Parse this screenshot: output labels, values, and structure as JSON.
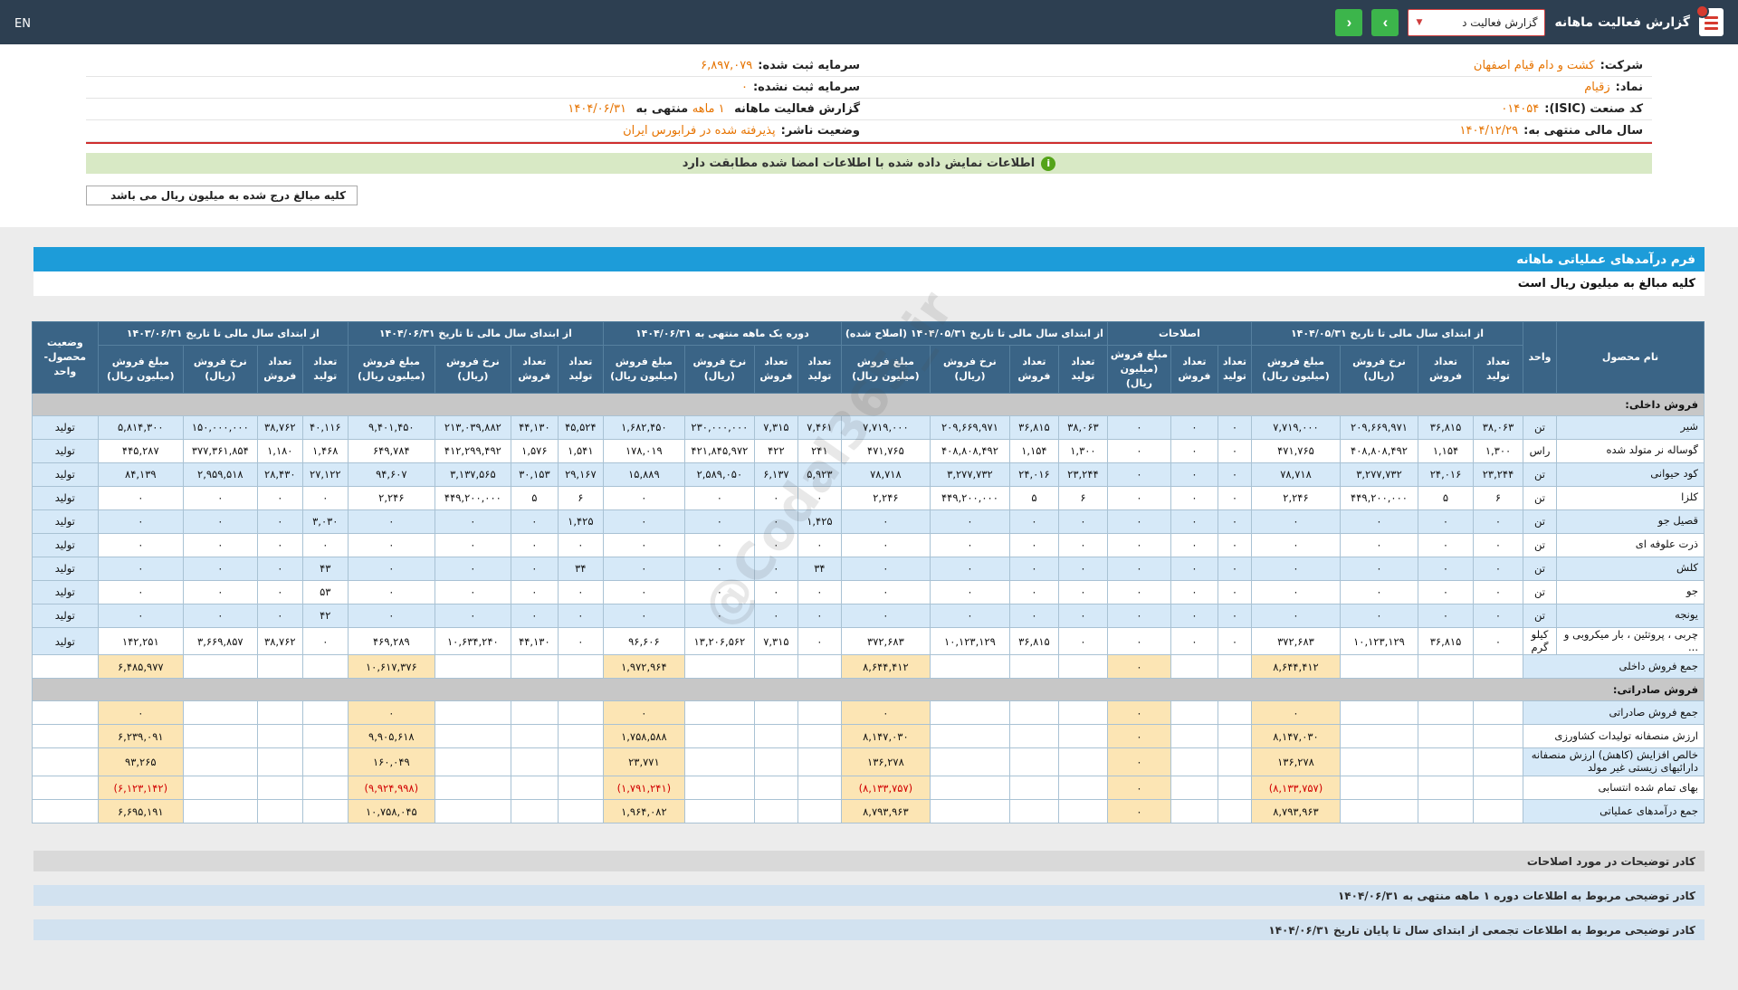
{
  "navbar": {
    "title": "گزارش فعالیت ماهانه",
    "dropdown_value": "گزارش فعالیت د",
    "arrow_next": "›",
    "arrow_prev": "‹",
    "lang": "EN",
    "accent_color": "#cf3d3d",
    "button_color": "#3cb54b"
  },
  "company_info": {
    "right": [
      {
        "label": "شرکت:",
        "value": "کشت و دام قیام اصفهان"
      },
      {
        "label": "نماد:",
        "value": "زقیام"
      },
      {
        "label": "کد صنعت (ISIC):",
        "value": "۰۱۴۰۵۴"
      },
      {
        "label": "سال مالی منتهی به:",
        "value": "۱۴۰۴/۱۲/۲۹"
      }
    ],
    "left": [
      {
        "label": "سرمایه ثبت شده:",
        "value": "۶,۸۹۷,۰۷۹"
      },
      {
        "label": "سرمایه ثبت نشده:",
        "value": "۰"
      },
      {
        "parts": [
          {
            "t": "گزارش فعالیت ماهانه ",
            "accent": false
          },
          {
            "t": "۱ ماهه",
            "accent": true
          },
          {
            "t": " منتهی به ",
            "accent": false
          },
          {
            "t": "۱۴۰۴/۰۶/۳۱",
            "accent": true
          }
        ]
      },
      {
        "label": "وضعیت ناشر:",
        "value": "پذیرفته شده در فرابورس ایران"
      }
    ]
  },
  "notice": "اطلاعات نمایش داده شده با اطلاعات امضا شده مطابقت دارد",
  "amounts_note_box": "کلیه مبالغ درج شده به میلیون ریال می باشد",
  "form": {
    "title": "فرم درآمدهای عملیاتی ماهانه",
    "subtitle": "کلیه مبالغ به میلیون ریال است"
  },
  "watermark": "@Codal365_ir",
  "table": {
    "col_product": "نام محصول",
    "col_unit": "واحد",
    "col_status": "وضعیت محصول-واحد",
    "sub": {
      "prod": "تعداد تولید",
      "sale": "تعداد فروش",
      "rate": "نرخ فروش (ریال)",
      "amt": "مبلغ فروش (میلیون ریال)"
    },
    "groups": [
      {
        "label": "از ابتدای سال مالی تا تاریخ ۱۴۰۴/۰۵/۳۱",
        "cols": [
          "prod",
          "sale",
          "rate",
          "amt"
        ]
      },
      {
        "label": "اصلاحات",
        "cols": [
          "prod",
          "sale",
          "amt"
        ]
      },
      {
        "label": "از ابتدای سال مالی تا تاریخ ۱۴۰۴/۰۵/۳۱ (اصلاح شده)",
        "cols": [
          "prod",
          "sale",
          "rate",
          "amt"
        ]
      },
      {
        "label": "دوره یک ماهه منتهی به ۱۴۰۴/۰۶/۳۱",
        "cols": [
          "prod",
          "sale",
          "rate",
          "amt"
        ]
      },
      {
        "label": "از ابتدای سال مالی تا تاریخ ۱۴۰۴/۰۶/۳۱",
        "cols": [
          "prod",
          "sale",
          "rate",
          "amt"
        ]
      },
      {
        "label": "از ابتدای سال مالی تا تاریخ ۱۴۰۳/۰۶/۳۱",
        "cols": [
          "prod",
          "sale",
          "rate",
          "amt"
        ]
      }
    ],
    "rows": [
      {
        "type": "section",
        "name": "فروش داخلی:"
      },
      {
        "type": "product",
        "name": "شیر",
        "unit": "تن",
        "status": "تولید",
        "cells": [
          "۳۸,۰۶۳",
          "۳۶,۸۱۵",
          "۲۰۹,۶۶۹,۹۷۱",
          "۷,۷۱۹,۰۰۰",
          "۰",
          "۰",
          "۰",
          "۳۸,۰۶۳",
          "۳۶,۸۱۵",
          "۲۰۹,۶۶۹,۹۷۱",
          "۷,۷۱۹,۰۰۰",
          "۷,۴۶۱",
          "۷,۳۱۵",
          "۲۳۰,۰۰۰,۰۰۰",
          "۱,۶۸۲,۴۵۰",
          "۴۵,۵۲۴",
          "۴۴,۱۳۰",
          "۲۱۳,۰۳۹,۸۸۲",
          "۹,۴۰۱,۴۵۰",
          "۴۰,۱۱۶",
          "۳۸,۷۶۲",
          "۱۵۰,۰۰۰,۰۰۰",
          "۵,۸۱۴,۳۰۰"
        ]
      },
      {
        "type": "product",
        "name": "گوساله نر متولد شده",
        "unit": "راس",
        "status": "تولید",
        "cells": [
          "۱,۳۰۰",
          "۱,۱۵۴",
          "۴۰۸,۸۰۸,۴۹۲",
          "۴۷۱,۷۶۵",
          "۰",
          "۰",
          "۰",
          "۱,۳۰۰",
          "۱,۱۵۴",
          "۴۰۸,۸۰۸,۴۹۲",
          "۴۷۱,۷۶۵",
          "۲۴۱",
          "۴۲۲",
          "۴۲۱,۸۴۵,۹۷۲",
          "۱۷۸,۰۱۹",
          "۱,۵۴۱",
          "۱,۵۷۶",
          "۴۱۲,۲۹۹,۴۹۲",
          "۶۴۹,۷۸۴",
          "۱,۴۶۸",
          "۱,۱۸۰",
          "۳۷۷,۳۶۱,۸۵۴",
          "۴۴۵,۲۸۷"
        ]
      },
      {
        "type": "product",
        "name": "کود حیوانی",
        "unit": "تن",
        "status": "تولید",
        "cells": [
          "۲۳,۲۴۴",
          "۲۴,۰۱۶",
          "۳,۲۷۷,۷۳۲",
          "۷۸,۷۱۸",
          "۰",
          "۰",
          "۰",
          "۲۳,۲۴۴",
          "۲۴,۰۱۶",
          "۳,۲۷۷,۷۳۲",
          "۷۸,۷۱۸",
          "۵,۹۲۳",
          "۶,۱۳۷",
          "۲,۵۸۹,۰۵۰",
          "۱۵,۸۸۹",
          "۲۹,۱۶۷",
          "۳۰,۱۵۳",
          "۳,۱۳۷,۵۶۵",
          "۹۴,۶۰۷",
          "۲۷,۱۲۲",
          "۲۸,۴۳۰",
          "۲,۹۵۹,۵۱۸",
          "۸۴,۱۳۹"
        ]
      },
      {
        "type": "product",
        "name": "کلزا",
        "unit": "تن",
        "status": "تولید",
        "cells": [
          "۶",
          "۵",
          "۴۴۹,۲۰۰,۰۰۰",
          "۲,۲۴۶",
          "۰",
          "۰",
          "۰",
          "۶",
          "۵",
          "۴۴۹,۲۰۰,۰۰۰",
          "۲,۲۴۶",
          "۰",
          "۰",
          "۰",
          "۰",
          "۶",
          "۵",
          "۴۴۹,۲۰۰,۰۰۰",
          "۲,۲۴۶",
          "۰",
          "۰",
          "۰",
          "۰"
        ]
      },
      {
        "type": "product",
        "name": "قصیل جو",
        "unit": "تن",
        "status": "تولید",
        "cells": [
          "۰",
          "۰",
          "۰",
          "۰",
          "۰",
          "۰",
          "۰",
          "۰",
          "۰",
          "۰",
          "۰",
          "۱,۴۲۵",
          "۰",
          "۰",
          "۰",
          "۱,۴۲۵",
          "۰",
          "۰",
          "۰",
          "۳,۰۳۰",
          "۰",
          "۰",
          "۰"
        ]
      },
      {
        "type": "product",
        "name": "ذرت علوفه ای",
        "unit": "تن",
        "status": "تولید",
        "cells": [
          "۰",
          "۰",
          "۰",
          "۰",
          "۰",
          "۰",
          "۰",
          "۰",
          "۰",
          "۰",
          "۰",
          "۰",
          "۰",
          "۰",
          "۰",
          "۰",
          "۰",
          "۰",
          "۰",
          "۰",
          "۰",
          "۰",
          "۰"
        ]
      },
      {
        "type": "product",
        "name": "کلش",
        "unit": "تن",
        "status": "تولید",
        "cells": [
          "۰",
          "۰",
          "۰",
          "۰",
          "۰",
          "۰",
          "۰",
          "۰",
          "۰",
          "۰",
          "۰",
          "۳۴",
          "۰",
          "۰",
          "۰",
          "۳۴",
          "۰",
          "۰",
          "۰",
          "۴۳",
          "۰",
          "۰",
          "۰"
        ]
      },
      {
        "type": "product",
        "name": "جو",
        "unit": "تن",
        "status": "تولید",
        "cells": [
          "۰",
          "۰",
          "۰",
          "۰",
          "۰",
          "۰",
          "۰",
          "۰",
          "۰",
          "۰",
          "۰",
          "۰",
          "۰",
          "۰",
          "۰",
          "۰",
          "۰",
          "۰",
          "۰",
          "۵۳",
          "۰",
          "۰",
          "۰"
        ]
      },
      {
        "type": "product",
        "name": "یونجه",
        "unit": "تن",
        "status": "تولید",
        "cells": [
          "۰",
          "۰",
          "۰",
          "۰",
          "۰",
          "۰",
          "۰",
          "۰",
          "۰",
          "۰",
          "۰",
          "۰",
          "۰",
          "۰",
          "۰",
          "۰",
          "۰",
          "۰",
          "۰",
          "۴۲",
          "۰",
          "۰",
          "۰"
        ]
      },
      {
        "type": "product",
        "name": "چربی ، پروتئین ، بار میکروبی و ...",
        "unit": "کیلو گرم",
        "status": "تولید",
        "cells": [
          "۰",
          "۳۶,۸۱۵",
          "۱۰,۱۲۳,۱۲۹",
          "۳۷۲,۶۸۳",
          "۰",
          "۰",
          "۰",
          "۰",
          "۳۶,۸۱۵",
          "۱۰,۱۲۳,۱۲۹",
          "۳۷۲,۶۸۳",
          "۰",
          "۷,۳۱۵",
          "۱۳,۲۰۶,۵۶۲",
          "۹۶,۶۰۶",
          "۰",
          "۴۴,۱۳۰",
          "۱۰,۶۳۴,۲۴۰",
          "۴۶۹,۲۸۹",
          "۰",
          "۳۸,۷۶۲",
          "۳,۶۶۹,۸۵۷",
          "۱۴۲,۲۵۱"
        ]
      },
      {
        "type": "sum",
        "name": "جمع فروش داخلی",
        "amounts": [
          "۸,۶۴۴,۴۱۲",
          "۰",
          "۸,۶۴۴,۴۱۲",
          "۱,۹۷۲,۹۶۴",
          "۱۰,۶۱۷,۳۷۶",
          "۶,۴۸۵,۹۷۷"
        ]
      },
      {
        "type": "section",
        "name": "فروش صادراتی:"
      },
      {
        "type": "sum",
        "name": "جمع فروش صادراتی",
        "amounts": [
          "۰",
          "۰",
          "۰",
          "۰",
          "۰",
          "۰"
        ]
      },
      {
        "type": "sum",
        "name": "ارزش منصفانه تولیدات کشاورزی",
        "amounts": [
          "۸,۱۴۷,۰۳۰",
          "۰",
          "۸,۱۴۷,۰۳۰",
          "۱,۷۵۸,۵۸۸",
          "۹,۹۰۵,۶۱۸",
          "۶,۲۳۹,۰۹۱"
        ]
      },
      {
        "type": "sum",
        "name": "خالص افزایش (کاهش) ارزش منصفانه دارائیهای زیستی غیر مولد",
        "amounts": [
          "۱۳۶,۲۷۸",
          "۰",
          "۱۳۶,۲۷۸",
          "۲۳,۷۷۱",
          "۱۶۰,۰۴۹",
          "۹۳,۲۶۵"
        ]
      },
      {
        "type": "sum",
        "name": "بهای تمام شده انتسابی",
        "amounts": [
          "(۸,۱۳۳,۷۵۷)",
          "۰",
          "(۸,۱۳۳,۷۵۷)",
          "(۱,۷۹۱,۲۴۱)",
          "(۹,۹۲۴,۹۹۸)",
          "(۶,۱۲۳,۱۴۲)"
        ]
      },
      {
        "type": "sum",
        "name": "جمع درآمدهای عملیاتی",
        "amounts": [
          "۸,۷۹۳,۹۶۳",
          "۰",
          "۸,۷۹۳,۹۶۳",
          "۱,۹۶۴,۰۸۲",
          "۱۰,۷۵۸,۰۴۵",
          "۶,۶۹۵,۱۹۱"
        ]
      }
    ]
  },
  "footer_bars": [
    "کادر توضیحات در مورد اصلاحات",
    "کادر توضیحی مربوط به اطلاعات دوره ۱ ماهه منتهی به ۱۴۰۴/۰۶/۳۱",
    "کادر توضیحی مربوط به اطلاعات تجمعی از ابتدای سال تا پایان تاریخ ۱۴۰۴/۰۶/۳۱"
  ]
}
